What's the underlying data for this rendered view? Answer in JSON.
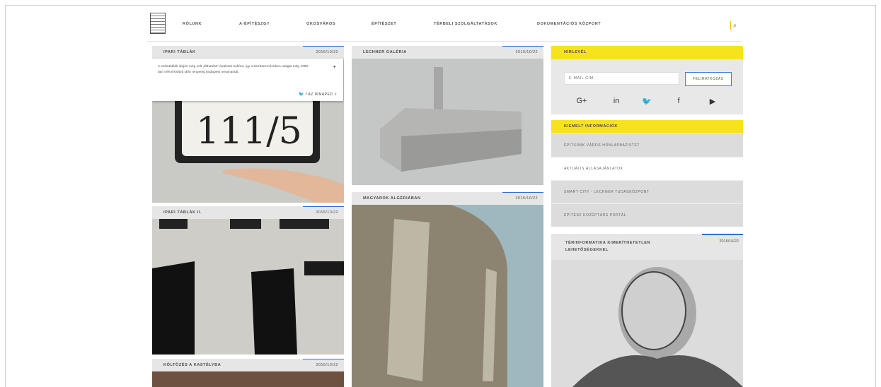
{
  "nav": {
    "items": [
      "RÓLUNK",
      "A-ÉPÍTÉSZGY",
      "OKOSVÁROS",
      "ÉPÍTÉSZET",
      "TÉRBELI SZOLGÁLTATÁSOK",
      "DOKUMENTÁCIÓS KÖZPONT"
    ],
    "search_icon": "search-icon"
  },
  "cards": {
    "ipari1": {
      "title": "IPARI TÁBLÁK",
      "date": "2015/10/22"
    },
    "popup": {
      "text": "A számtáblák idején még volt „láthatósz\" épületek kultúra, így a körútszeméenben utalgat még 1980-ban néhol kiöltött időn rengeteg budapest megmaradt.",
      "share_label": "AZ ÍRNAPED"
    },
    "ipari2": {
      "title": "IPARI TÁBLÁK II.",
      "date": "2015/10/22"
    },
    "koltozes": {
      "title": "KÖLTÖZÉS A KASTÉLYBA",
      "date": "2015/10/22"
    },
    "lechner": {
      "title": "LECHNER GALÉRIA",
      "date": "2015/10/22"
    },
    "magyarok": {
      "title": "MAGYAROK ALGÉRIÁBAN",
      "date": "2015/10/22"
    }
  },
  "sidebar": {
    "newsletter_title": "HÍRLEVÉL",
    "email_placeholder": "E-MAIL CÍM",
    "subscribe_label": "FELIRATKOZÁS",
    "social": [
      "G+",
      "in",
      "twitter",
      "f",
      "youtube"
    ],
    "highlight_title": "KIEMELT INFORMÁCIÓK",
    "links": [
      "ÉPÍTSÜNK VÁROS HONLAPBÁZISTÉT",
      "AKTUÁLIS ÁLLÁSAJÁNLATOK",
      "SMART CITY - LECHNER TUDÁSKÖZPONT",
      "ÉPÍTÉSZ KOZÉPTÁRS PORTÁL"
    ],
    "side_card": {
      "title": "TÉRINFORMATIKA KIMERÍTHETETLEN LEHETŐSÉGEKKEL",
      "date": "2015/10/22"
    }
  }
}
